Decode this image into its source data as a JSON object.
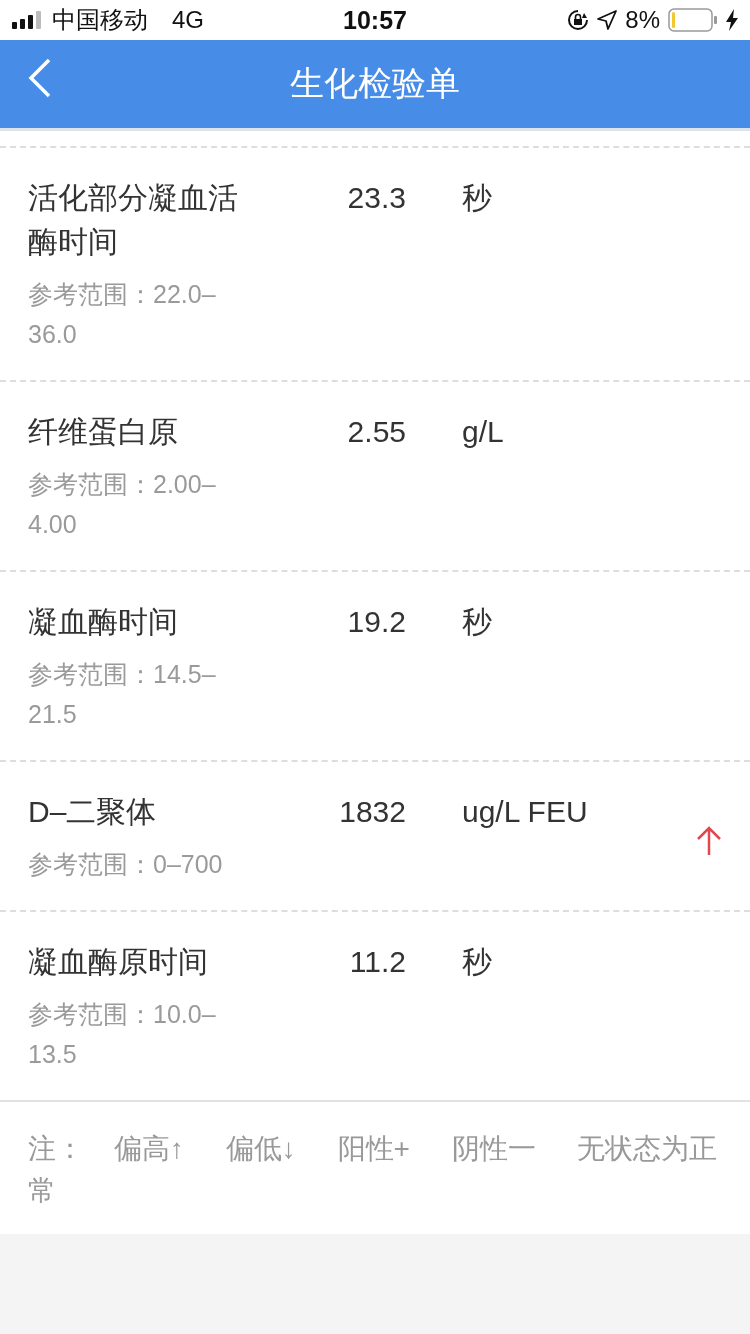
{
  "status_bar": {
    "carrier": "中国移动",
    "network": "4G",
    "time": "10:57",
    "battery_percent": "8%",
    "charging": true
  },
  "nav": {
    "title": "生化检验单"
  },
  "results": [
    {
      "name": "活化部分凝血活酶时间",
      "value": "23.3",
      "unit": "秒",
      "reference": "参考范围：22.0–36.0",
      "high": false
    },
    {
      "name": "纤维蛋白原",
      "value": "2.55",
      "unit": "g/L",
      "reference": "参考范围：2.00–4.00",
      "high": false
    },
    {
      "name": "凝血酶时间",
      "value": "19.2",
      "unit": "秒",
      "reference": "参考范围：14.5–21.5",
      "high": false
    },
    {
      "name": "D–二聚体",
      "value": "1832",
      "unit": "ug/L FEU",
      "reference": "参考范围：0–700",
      "high": true
    },
    {
      "name": "凝血酶原时间",
      "value": "11.2",
      "unit": "秒",
      "reference": "参考范围：10.0–13.5",
      "high": false
    }
  ],
  "legend": {
    "label": "注：",
    "items": [
      "偏高↑",
      "偏低↓",
      "阳性+",
      "阴性一",
      "无状态为正常"
    ]
  }
}
